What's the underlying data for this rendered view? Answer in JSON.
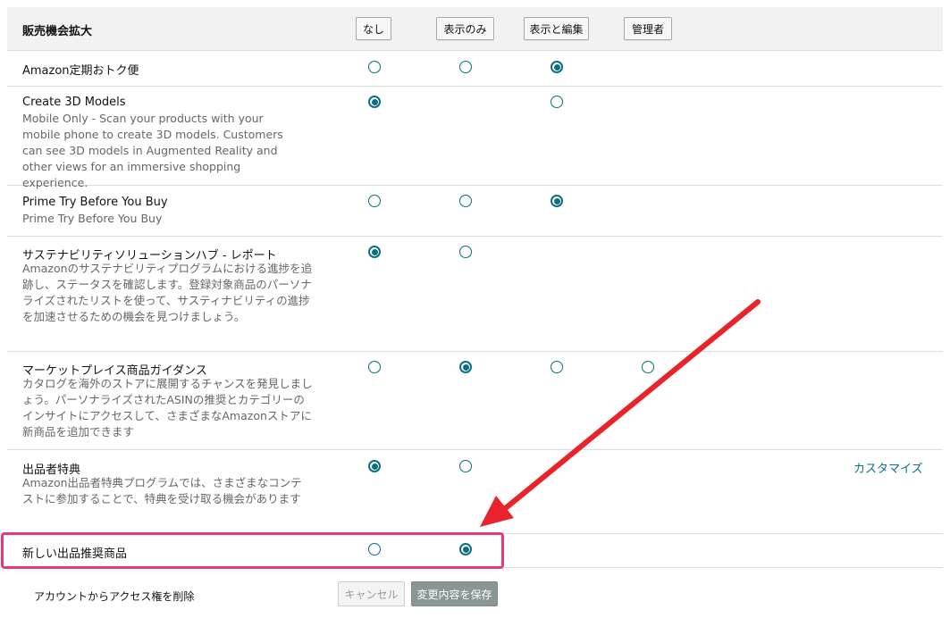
{
  "header": {
    "title": "販売機会拡大",
    "columns": [
      "なし",
      "表示のみ",
      "表示と編集",
      "管理者"
    ]
  },
  "rows": [
    {
      "title": "Amazon定期おトク便",
      "desc": "",
      "selected": "表示と編集"
    },
    {
      "title": "Create 3D Models",
      "desc": "Mobile Only - Scan your products with your mobile phone to create 3D models. Customers can see 3D models in Augmented Reality and other views for an immersive shopping experience.",
      "selected": "なし"
    },
    {
      "title": "Prime Try Before You Buy",
      "desc": "Prime Try Before You Buy",
      "selected": "表示と編集"
    },
    {
      "title": "サステナビリティソリューションハブ - レポート",
      "desc": "Amazonのサステナビリティプログラムにおける進捗を追跡し、ステータスを確認します。登録対象商品のパーソナライズされたリストを使って、サスティナビリティの進捗を加速させるための機会を見つけましょう。",
      "selected": "なし"
    },
    {
      "title": "マーケットプレイス商品ガイダンス",
      "desc": "カタログを海外のストアに展開するチャンスを発見しましょう。パーソナライズされたASINの推奨とカテゴリーのインサイトにアクセスして、さまざまなAmazonストアに新商品を追加できます",
      "selected": "表示のみ"
    },
    {
      "title": "出品者特典",
      "desc": "Amazon出品者特典プログラムでは、さまざまなコンテストに参加することで、特典を受け取る機会があります",
      "selected": "なし",
      "link": "カスタマイズ"
    },
    {
      "title": "新しい出品推奨商品",
      "desc": "",
      "selected": "表示のみ"
    }
  ],
  "footer": {
    "remove_access": "アカウントからアクセス権を削除",
    "cancel": "キャンセル",
    "save": "変更内容を保存"
  },
  "annotation": {
    "arrow_color": "#e8232b",
    "highlight_color": "#ea3a72"
  },
  "accent_color": "#0b6e7f"
}
